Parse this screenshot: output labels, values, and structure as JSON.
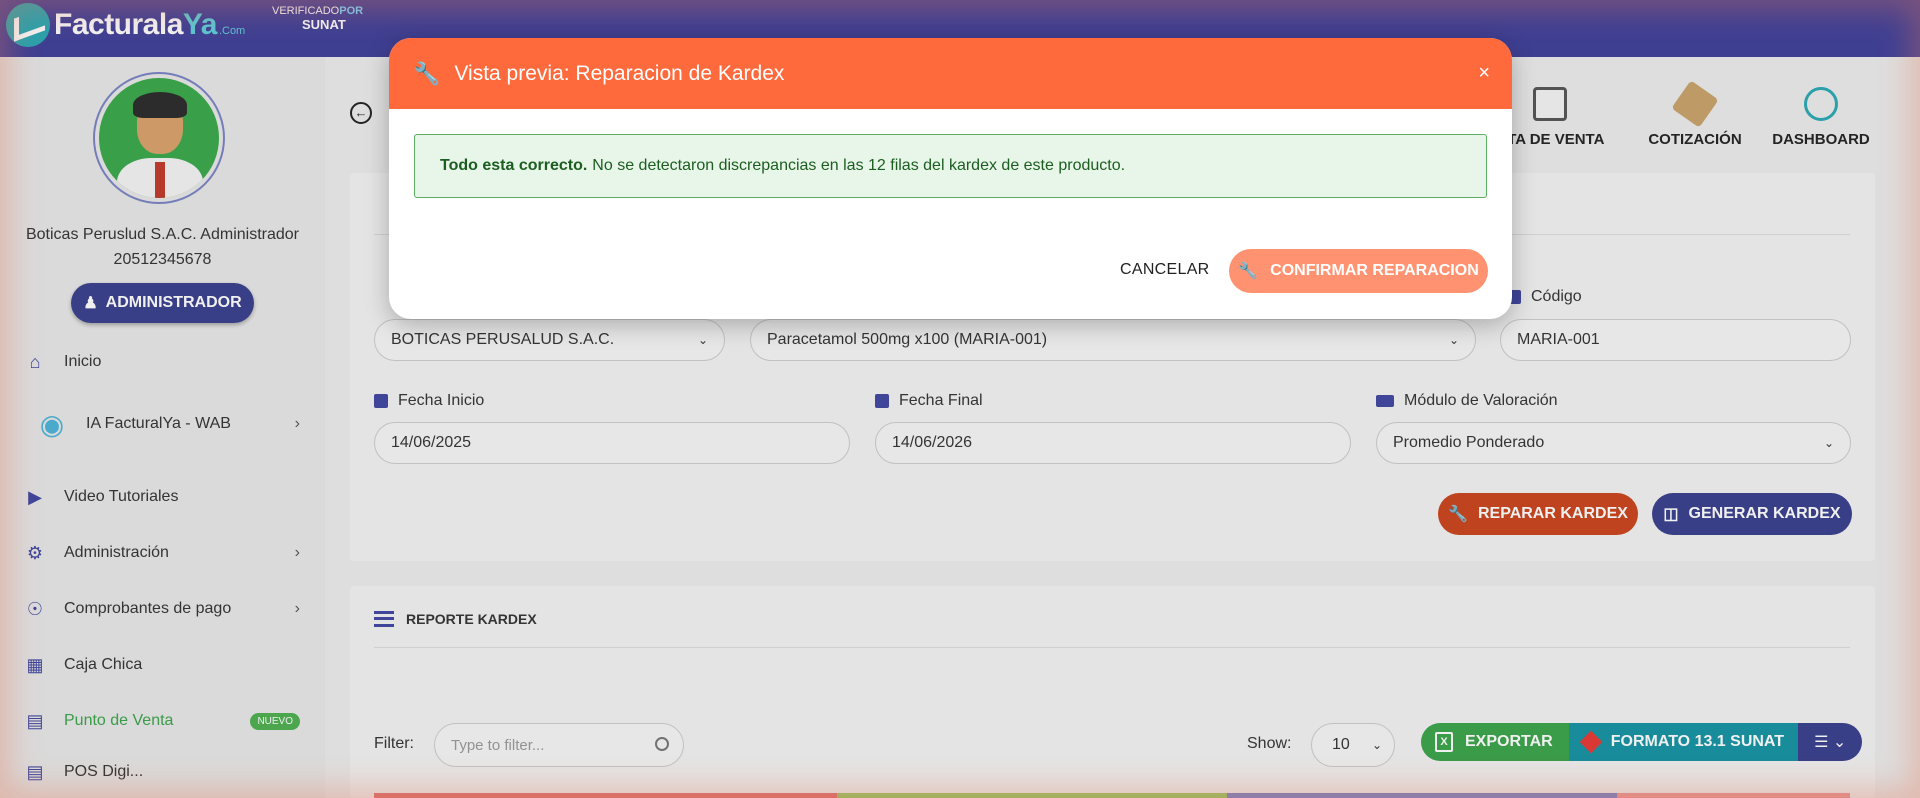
{
  "app": {
    "logo_main": "Facturala",
    "logo_ya": "Ya",
    "logo_com": ".Com",
    "verif_line1": "VERIFICADO",
    "verif_por": "POR",
    "verif_line2": "SUNAT"
  },
  "user": {
    "name": "Boticas Peruslud S.A.C. Administrador",
    "ruc": "20512345678",
    "role": "ADMINISTRADOR"
  },
  "sidebar": {
    "items": [
      {
        "label": "Inicio",
        "icon": "home-icon"
      },
      {
        "label": "IA FacturalYa - WAB",
        "icon": "robot-icon"
      },
      {
        "label": "Video Tutoriales",
        "icon": "video-icon"
      },
      {
        "label": "Administración",
        "icon": "gear-icon"
      },
      {
        "label": "Comprobantes de pago",
        "icon": "eye-icon"
      },
      {
        "label": "Caja Chica",
        "icon": "calculator-icon"
      },
      {
        "label": "Punto de Venta",
        "icon": "store-icon",
        "badge": "NUEVO"
      },
      {
        "label": "POS Digi...",
        "icon": "pos-icon"
      }
    ]
  },
  "header": {
    "quick_links": [
      {
        "label": "NOTA DE VENTA",
        "visible": "OTA DE VENTA"
      },
      {
        "label": "COTIZACIÓN"
      },
      {
        "label": "DASHBOARD"
      }
    ]
  },
  "form": {
    "company": {
      "value": "BOTICAS PERUSALUD S.A.C."
    },
    "product": {
      "value": "Paracetamol 500mg x100 (MARIA-001)"
    },
    "codigo": {
      "label": "Código",
      "value": "MARIA-001"
    },
    "fecha_inicio": {
      "label": "Fecha Inicio",
      "value": "14/06/2025"
    },
    "fecha_final": {
      "label": "Fecha Final",
      "value": "14/06/2026"
    },
    "modulo": {
      "label": "Módulo de Valoración",
      "value": "Promedio Ponderado"
    },
    "repair_label": "REPARAR KARDEX",
    "generate_label": "GENERAR KARDEX"
  },
  "report": {
    "title": "REPORTE KARDEX",
    "filter_label": "Filter:",
    "filter_placeholder": "Type to filter...",
    "show_label": "Show:",
    "show_value": "10",
    "export_label": "EXPORTAR",
    "sunat_label": "FORMATO 13.1 SUNAT"
  },
  "modal": {
    "title": "Vista previa: Reparacion de Kardex",
    "alert_strong": "Todo esta correcto.",
    "alert_text": "No se detectaron discrepancias en las 12 filas del kardex de este producto.",
    "cancel_label": "CANCELAR",
    "confirm_label": "CONFIRMAR REPARACION"
  },
  "colors": {
    "primary": "#393f8c",
    "accent": "#ff6a3d",
    "success": "#3aa34a",
    "teal": "#1593a3"
  }
}
